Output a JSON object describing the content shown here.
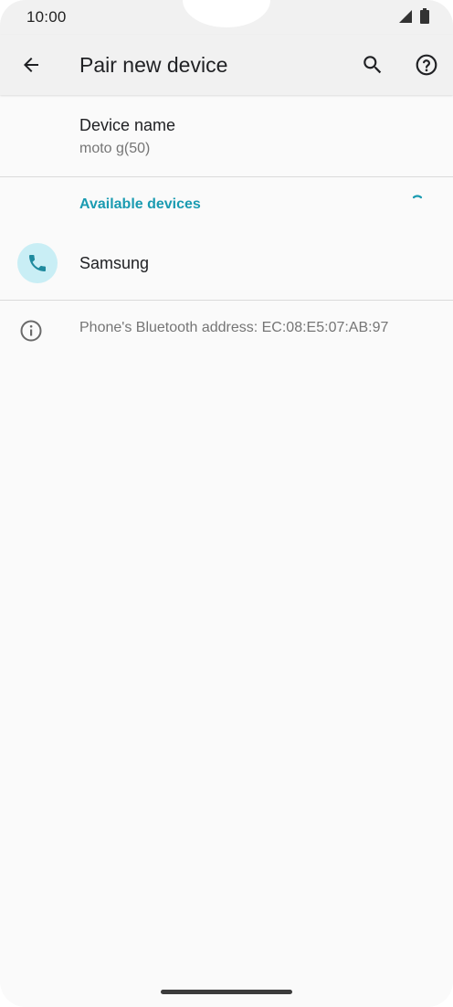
{
  "status_bar": {
    "time": "10:00",
    "icons": [
      "signal-icon",
      "battery-icon"
    ]
  },
  "app_bar": {
    "title": "Pair new device",
    "back_icon": "arrow-back-icon",
    "search_icon": "search-icon",
    "help_icon": "help-icon"
  },
  "device_name": {
    "label": "Device name",
    "value": "moto g(50)"
  },
  "available_devices": {
    "header": "Available devices",
    "items": [
      {
        "label": "Samsung",
        "icon": "phone-icon"
      }
    ]
  },
  "footer": {
    "address_text": "Phone's Bluetooth address: EC:08:E5:07:AB:97",
    "icon": "info-icon"
  },
  "colors": {
    "accent": "#1a9bb1",
    "avatar_bg": "#c9eef5",
    "phone_icon": "#1f8a9e",
    "app_bar_bg": "#f1f1f1",
    "background": "#fafafa"
  }
}
